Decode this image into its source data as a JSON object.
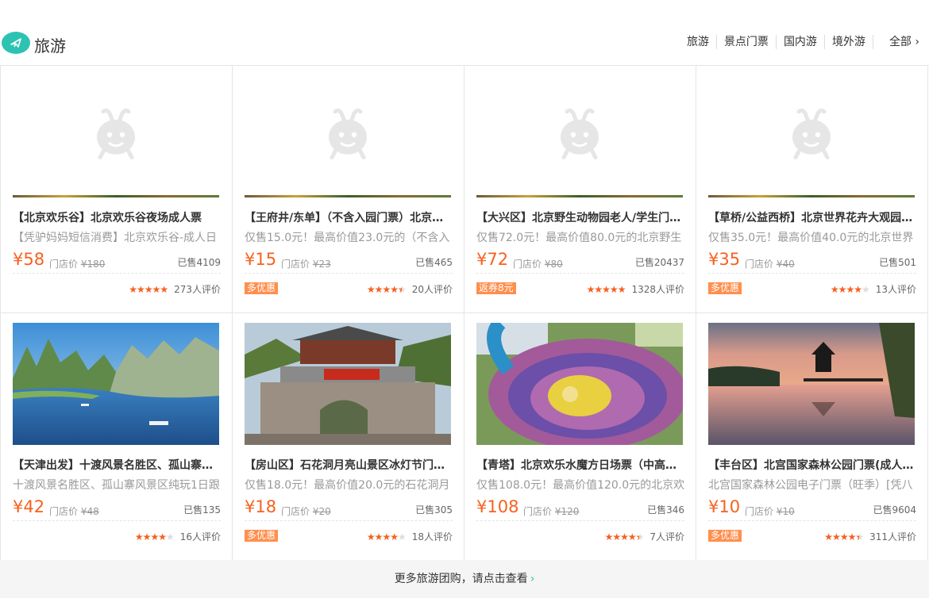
{
  "header": {
    "title": "旅游",
    "nav": [
      "旅游",
      "景点门票",
      "国内游",
      "境外游"
    ],
    "all_label": "全部 ›"
  },
  "cards": [
    {
      "title": "【北京欢乐谷】北京欢乐谷夜场成人票",
      "desc": "【凭驴妈妈短信消费】北京欢乐谷-成人日",
      "price": "¥58",
      "store_label": "门店价",
      "store_price": "¥180",
      "sold": "已售4109",
      "tag": "",
      "rating": 5,
      "reviews": "273人评价",
      "image": "placeholder"
    },
    {
      "title": "【王府井/东单】（不含入园门票）北京…",
      "desc": "仅售15.0元！最高价值23.0元的（不含入",
      "price": "¥15",
      "store_label": "门店价",
      "store_price": "¥23",
      "sold": "已售465",
      "tag": "多优惠",
      "rating": 4.5,
      "reviews": "20人评价",
      "image": "placeholder"
    },
    {
      "title": "【大兴区】北京野生动物园老人/学生门…",
      "desc": "仅售72.0元！最高价值80.0元的北京野生",
      "price": "¥72",
      "store_label": "门店价",
      "store_price": "¥80",
      "sold": "已售20437",
      "tag": "返券8元",
      "rating": 5,
      "reviews": "1328人评价",
      "image": "placeholder"
    },
    {
      "title": "【草桥/公益西桥】北京世界花卉大观园…",
      "desc": "仅售35.0元！最高价值40.0元的北京世界",
      "price": "¥35",
      "store_label": "门店价",
      "store_price": "¥40",
      "sold": "已售501",
      "tag": "多优惠",
      "rating": 4,
      "reviews": "13人评价",
      "image": "placeholder"
    },
    {
      "title": "【天津出发】十渡风景名胜区、孤山寨风…",
      "desc": "十渡风景名胜区、孤山寨风景区纯玩1日跟",
      "price": "¥42",
      "store_label": "门店价",
      "store_price": "¥48",
      "sold": "已售135",
      "tag": "",
      "rating": 4,
      "reviews": "16人评价",
      "image": "mountains"
    },
    {
      "title": "【房山区】石花洞月亮山景区冰灯节门票…",
      "desc": "仅售18.0元！最高价值20.0元的石花洞月",
      "price": "¥18",
      "store_label": "门店价",
      "store_price": "¥20",
      "sold": "已售305",
      "tag": "多优惠",
      "rating": 4,
      "reviews": "18人评价",
      "image": "gate"
    },
    {
      "title": "【青塔】北京欢乐水魔方日场票（中高考…",
      "desc": "仅售108.0元！最高价值120.0元的北京欢",
      "price": "¥108",
      "store_label": "门店价",
      "store_price": "¥120",
      "sold": "已售346",
      "tag": "",
      "rating": 4.5,
      "reviews": "7人评价",
      "image": "waterslide"
    },
    {
      "title": "【丰台区】北宫国家森林公园门票(成人票)",
      "desc": "北宫国家森林公园电子门票（旺季）[凭八",
      "price": "¥10",
      "store_label": "门店价",
      "store_price": "¥10",
      "sold": "已售9604",
      "tag": "多优惠",
      "rating": 4.5,
      "reviews": "311人评价",
      "image": "sunset"
    }
  ],
  "more_label": "更多旅游团购，请点击查看",
  "colors": {
    "accent": "#2dc3b3",
    "price": "#f76120",
    "tag": "#ff8f4e"
  }
}
